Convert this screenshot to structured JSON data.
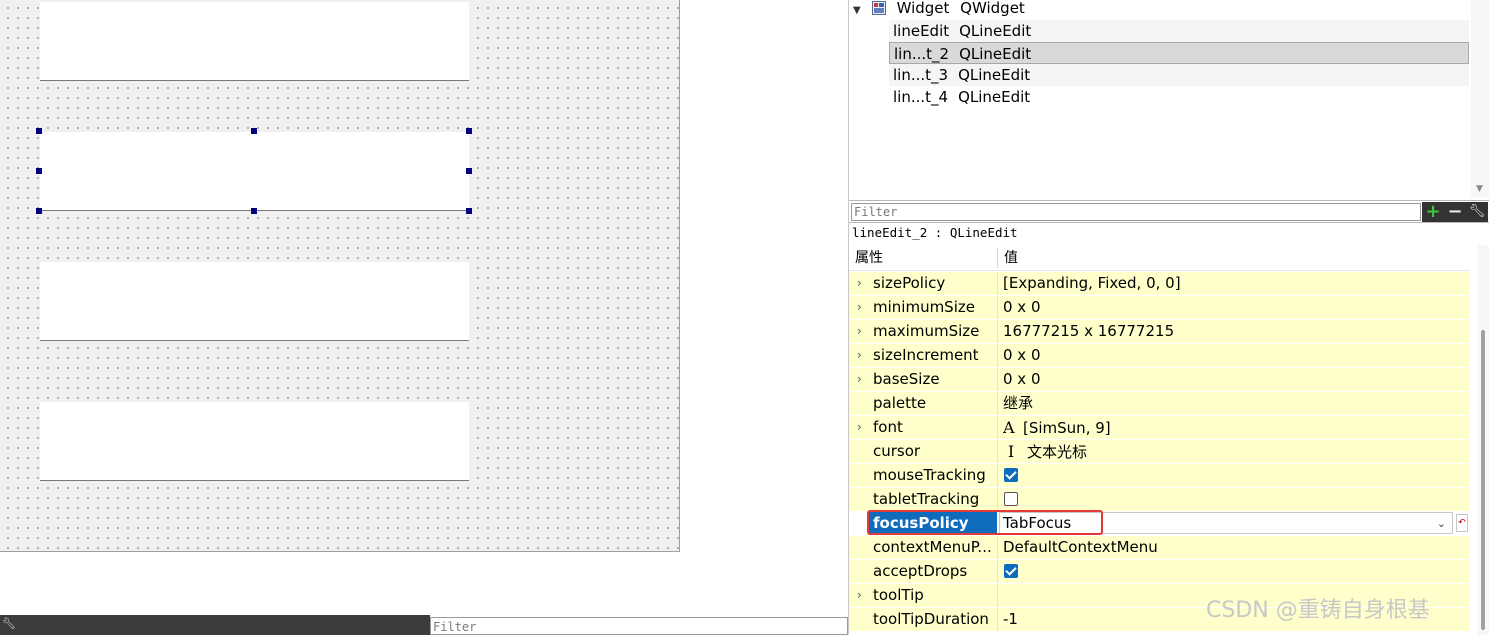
{
  "object_inspector": {
    "root": {
      "name": "Widget",
      "class": "QWidget"
    },
    "children": [
      {
        "name": "lineEdit",
        "class": "QLineEdit"
      },
      {
        "name": "lin...t_2",
        "class": "QLineEdit"
      },
      {
        "name": "lin...t_3",
        "class": "QLineEdit"
      },
      {
        "name": "lin...t_4",
        "class": "QLineEdit"
      }
    ],
    "selected_index": 1
  },
  "property_filter": {
    "placeholder": "Filter"
  },
  "bottom_filter": {
    "placeholder": "Filter"
  },
  "selected_object": "lineEdit_2 : QLineEdit",
  "property_editor": {
    "col_property": "属性",
    "col_value": "值",
    "rows": [
      {
        "name": "sizePolicy",
        "value": "[Expanding, Fixed, 0, 0]",
        "expandable": true
      },
      {
        "name": "minimumSize",
        "value": "0 x 0",
        "expandable": true
      },
      {
        "name": "maximumSize",
        "value": "16777215 x 16777215",
        "expandable": true
      },
      {
        "name": "sizeIncrement",
        "value": "0 x 0",
        "expandable": true
      },
      {
        "name": "baseSize",
        "value": "0 x 0",
        "expandable": true
      },
      {
        "name": "palette",
        "value": "继承",
        "expandable": false
      },
      {
        "name": "font",
        "value": "[SimSun, 9]",
        "expandable": true,
        "icon": "font-icon"
      },
      {
        "name": "cursor",
        "value": "文本光标",
        "expandable": false,
        "icon": "text-cursor-icon"
      },
      {
        "name": "mouseTracking",
        "checked": true
      },
      {
        "name": "tabletTracking",
        "checked": false
      },
      {
        "name": "focusPolicy",
        "value": "TabFocus",
        "selected": true
      },
      {
        "name": "contextMenuP...",
        "value": "DefaultContextMenu",
        "expandable": false
      },
      {
        "name": "acceptDrops",
        "checked": true
      },
      {
        "name": "toolTip",
        "value": "",
        "expandable": true
      },
      {
        "name": "toolTipDuration",
        "value": "-1",
        "expandable": false
      }
    ]
  },
  "icons": {
    "add": "plus-icon",
    "remove": "minus-icon",
    "configure": "wrench-icon"
  },
  "colors": {
    "selection_blue": "#0f6cbd",
    "property_row": "#ffffcc",
    "highlight_red": "#e53935",
    "add_green": "#3cc43c"
  },
  "watermark": "CSDN @重铸自身根基"
}
